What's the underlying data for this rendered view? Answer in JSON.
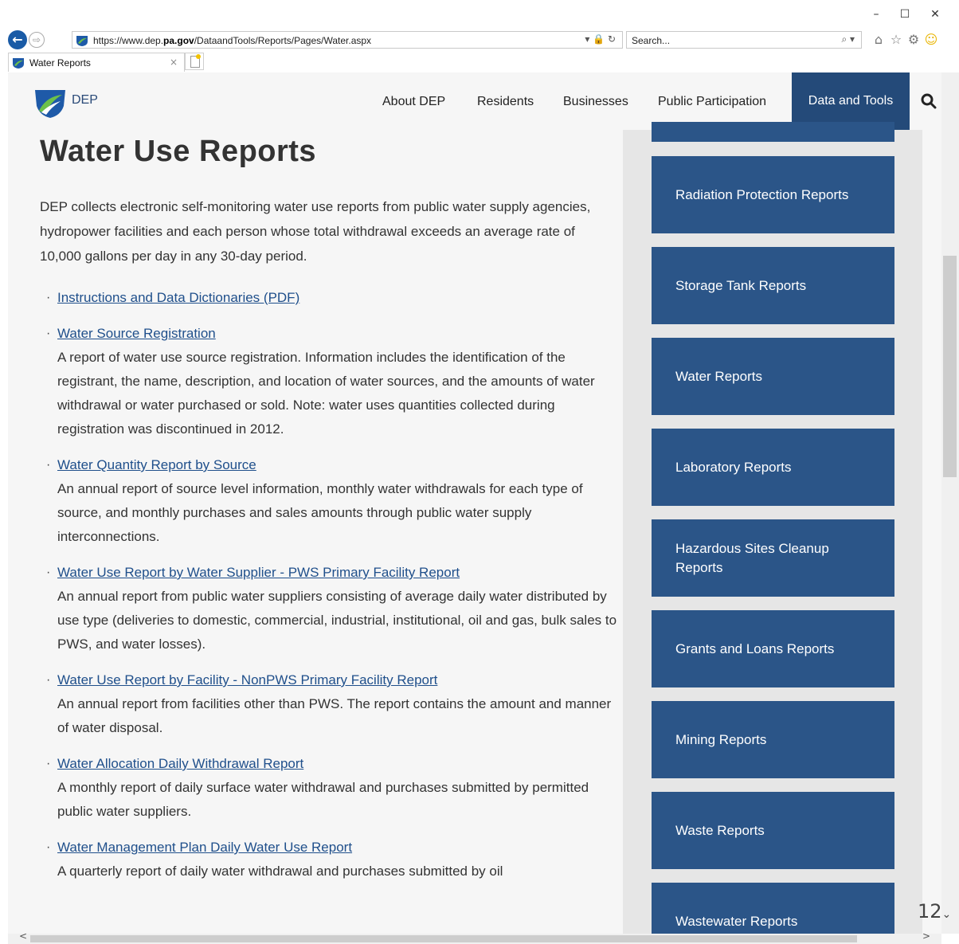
{
  "browser": {
    "url_prefix": "https://www.dep.",
    "url_domain": "pa.gov",
    "url_path": "/DataandTools/Reports/Pages/Water.aspx",
    "url_controls": "▾ 🔒 ↻",
    "search_placeholder": "Search...",
    "search_controls": "⌕ ▾",
    "tab_title": "Water Reports",
    "tab_close": "×",
    "window_controls": {
      "minimize": "–",
      "maximize": "☐",
      "close": "✕"
    },
    "toolbar_icons": {
      "home": "⌂",
      "favorites": "☆",
      "settings": "⚙",
      "smiley": "☺"
    },
    "back": "←",
    "forward": "⇨"
  },
  "site": {
    "logo_text": "DEP",
    "nav": [
      "About DEP",
      "Residents",
      "Businesses",
      "Public Participation"
    ],
    "nav_active": "Data and Tools"
  },
  "main": {
    "title": "Water Use Reports",
    "intro": "DEP collects electronic self-monitoring water use reports from public water supply agencies, hydropower facilities and each person whose total withdrawal exceeds an average rate of 10,000 gallons per day in any 30-day period.",
    "reports": [
      {
        "title": "Instructions and Data Dictionaries (PDF)",
        "desc": ""
      },
      {
        "title": "Water Source Registration",
        "desc": "A report of water use source registration. Information includes the identification of the registrant, the name, description, and location of water sources, and the amounts of water withdrawal or water purchased or sold. Note: water uses quantities collected during registration was discontinued in 2012."
      },
      {
        "title": "Water Quantity Report by Source",
        "desc": "An annual report of source level information, monthly water withdrawals for each type of source, and monthly purchases and sales amounts through public water supply interconnections."
      },
      {
        "title": "Water Use Report by Water Supplier - PWS Primary Facility Report",
        "desc": "An annual report from public water suppliers consisting of average daily water distributed by use type (deliveries to domestic, commercial, industrial, institutional, oil and gas, bulk sales to PWS, and water losses)."
      },
      {
        "title": "Water Use Report by Facility - NonPWS Primary Facility Report",
        "desc": "An annual report from facilities other than PWS. The report contains the amount and manner of water disposal."
      },
      {
        "title": "Water Allocation Daily Withdrawal Report",
        "desc": "A monthly report of daily surface water withdrawal and purchases submitted by permitted public water suppliers."
      },
      {
        "title": "Water Management Plan Daily Water Use Report",
        "desc": "A quarterly report of daily water withdrawal and purchases submitted by oil"
      }
    ]
  },
  "sidebar": {
    "items": [
      "Radiation Protection Reports",
      "Storage Tank Reports",
      "Water Reports",
      "Laboratory Reports",
      "Hazardous Sites Cleanup Reports",
      "Grants and Loans Reports",
      "Mining Reports",
      "Waste Reports",
      "Wastewater Reports"
    ]
  },
  "zoom": {
    "value": "12",
    "chevron": "⌄"
  },
  "scroll": {
    "left": "<",
    "right": ">"
  },
  "colors": {
    "accent": "#244a79",
    "tile": "#2b5588",
    "link": "#1f4f8b"
  }
}
